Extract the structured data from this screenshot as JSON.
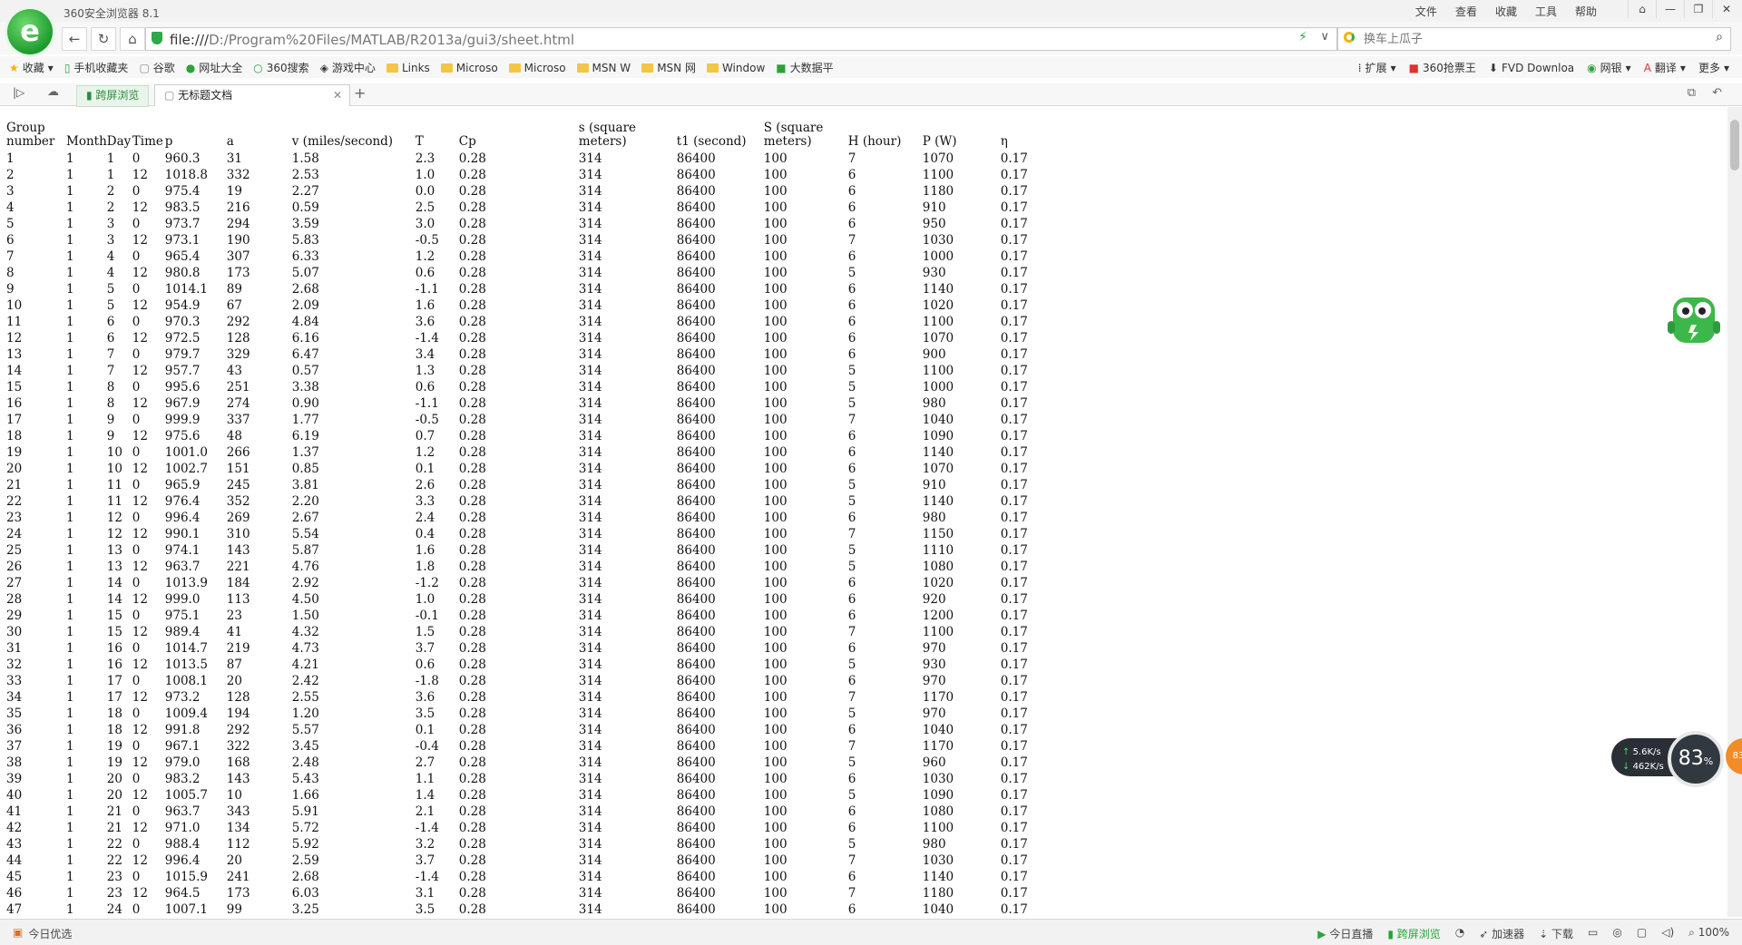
{
  "window": {
    "title": "360安全浏览器 8.1",
    "menus": [
      "文件",
      "查看",
      "收藏",
      "工具",
      "帮助"
    ]
  },
  "address": {
    "protocol": "file:///",
    "path": "D:/Program%20Files/MATLAB/R2013a/gui3/sheet.html"
  },
  "search": {
    "placeholder": "换车上瓜子"
  },
  "bookmarks": {
    "left": [
      "收藏",
      "手机收藏夹",
      "谷歌",
      "网址大全",
      "360搜索",
      "游戏中心",
      "Links",
      "Microso",
      "Microso",
      "MSN W",
      "MSN 网",
      "Window",
      "大数据平"
    ],
    "right": [
      "扩展",
      "360抢票王",
      "FVD Downloa",
      "网银",
      "翻译",
      "更多"
    ]
  },
  "tabs": {
    "cross_screen": "跨屏浏览",
    "active": "无标题文档",
    "new_tab": "+"
  },
  "table": {
    "headers": [
      "Group number",
      "Month",
      "Day",
      "Time",
      "p",
      "a",
      "v (miles/second)",
      "T",
      "Cp",
      "s (square meters)",
      "t1 (second)",
      "S (square meters)",
      "H (hour)",
      "P (W)",
      "η"
    ],
    "rows": [
      [
        "1",
        "1",
        "1",
        "0",
        "960.3",
        "31",
        "1.58",
        "2.3",
        "0.28",
        "314",
        "86400",
        "100",
        "7",
        "1070",
        "0.17"
      ],
      [
        "2",
        "1",
        "1",
        "12",
        "1018.8",
        "332",
        "2.53",
        "1.0",
        "0.28",
        "314",
        "86400",
        "100",
        "6",
        "1100",
        "0.17"
      ],
      [
        "3",
        "1",
        "2",
        "0",
        "975.4",
        "19",
        "2.27",
        "0.0",
        "0.28",
        "314",
        "86400",
        "100",
        "6",
        "1180",
        "0.17"
      ],
      [
        "4",
        "1",
        "2",
        "12",
        "983.5",
        "216",
        "0.59",
        "2.5",
        "0.28",
        "314",
        "86400",
        "100",
        "6",
        "910",
        "0.17"
      ],
      [
        "5",
        "1",
        "3",
        "0",
        "973.7",
        "294",
        "3.59",
        "3.0",
        "0.28",
        "314",
        "86400",
        "100",
        "6",
        "950",
        "0.17"
      ],
      [
        "6",
        "1",
        "3",
        "12",
        "973.1",
        "190",
        "5.83",
        "-0.5",
        "0.28",
        "314",
        "86400",
        "100",
        "7",
        "1030",
        "0.17"
      ],
      [
        "7",
        "1",
        "4",
        "0",
        "965.4",
        "307",
        "6.33",
        "1.2",
        "0.28",
        "314",
        "86400",
        "100",
        "6",
        "1000",
        "0.17"
      ],
      [
        "8",
        "1",
        "4",
        "12",
        "980.8",
        "173",
        "5.07",
        "0.6",
        "0.28",
        "314",
        "86400",
        "100",
        "5",
        "930",
        "0.17"
      ],
      [
        "9",
        "1",
        "5",
        "0",
        "1014.1",
        "89",
        "2.68",
        "-1.1",
        "0.28",
        "314",
        "86400",
        "100",
        "6",
        "1140",
        "0.17"
      ],
      [
        "10",
        "1",
        "5",
        "12",
        "954.9",
        "67",
        "2.09",
        "1.6",
        "0.28",
        "314",
        "86400",
        "100",
        "6",
        "1020",
        "0.17"
      ],
      [
        "11",
        "1",
        "6",
        "0",
        "970.3",
        "292",
        "4.84",
        "3.6",
        "0.28",
        "314",
        "86400",
        "100",
        "6",
        "1100",
        "0.17"
      ],
      [
        "12",
        "1",
        "6",
        "12",
        "972.5",
        "128",
        "6.16",
        "-1.4",
        "0.28",
        "314",
        "86400",
        "100",
        "6",
        "1070",
        "0.17"
      ],
      [
        "13",
        "1",
        "7",
        "0",
        "979.7",
        "329",
        "6.47",
        "3.4",
        "0.28",
        "314",
        "86400",
        "100",
        "6",
        "900",
        "0.17"
      ],
      [
        "14",
        "1",
        "7",
        "12",
        "957.7",
        "43",
        "0.57",
        "1.3",
        "0.28",
        "314",
        "86400",
        "100",
        "5",
        "1100",
        "0.17"
      ],
      [
        "15",
        "1",
        "8",
        "0",
        "995.6",
        "251",
        "3.38",
        "0.6",
        "0.28",
        "314",
        "86400",
        "100",
        "5",
        "1000",
        "0.17"
      ],
      [
        "16",
        "1",
        "8",
        "12",
        "967.9",
        "274",
        "0.90",
        "-1.1",
        "0.28",
        "314",
        "86400",
        "100",
        "5",
        "980",
        "0.17"
      ],
      [
        "17",
        "1",
        "9",
        "0",
        "999.9",
        "337",
        "1.77",
        "-0.5",
        "0.28",
        "314",
        "86400",
        "100",
        "7",
        "1040",
        "0.17"
      ],
      [
        "18",
        "1",
        "9",
        "12",
        "975.6",
        "48",
        "6.19",
        "0.7",
        "0.28",
        "314",
        "86400",
        "100",
        "6",
        "1090",
        "0.17"
      ],
      [
        "19",
        "1",
        "10",
        "0",
        "1001.0",
        "266",
        "1.37",
        "1.2",
        "0.28",
        "314",
        "86400",
        "100",
        "6",
        "1140",
        "0.17"
      ],
      [
        "20",
        "1",
        "10",
        "12",
        "1002.7",
        "151",
        "0.85",
        "0.1",
        "0.28",
        "314",
        "86400",
        "100",
        "6",
        "1070",
        "0.17"
      ],
      [
        "21",
        "1",
        "11",
        "0",
        "965.9",
        "245",
        "3.81",
        "2.6",
        "0.28",
        "314",
        "86400",
        "100",
        "5",
        "910",
        "0.17"
      ],
      [
        "22",
        "1",
        "11",
        "12",
        "976.4",
        "352",
        "2.20",
        "3.3",
        "0.28",
        "314",
        "86400",
        "100",
        "5",
        "1140",
        "0.17"
      ],
      [
        "23",
        "1",
        "12",
        "0",
        "996.4",
        "269",
        "2.67",
        "2.4",
        "0.28",
        "314",
        "86400",
        "100",
        "6",
        "980",
        "0.17"
      ],
      [
        "24",
        "1",
        "12",
        "12",
        "990.1",
        "310",
        "5.54",
        "0.4",
        "0.28",
        "314",
        "86400",
        "100",
        "7",
        "1150",
        "0.17"
      ],
      [
        "25",
        "1",
        "13",
        "0",
        "974.1",
        "143",
        "5.87",
        "1.6",
        "0.28",
        "314",
        "86400",
        "100",
        "5",
        "1110",
        "0.17"
      ],
      [
        "26",
        "1",
        "13",
        "12",
        "963.7",
        "221",
        "4.76",
        "1.8",
        "0.28",
        "314",
        "86400",
        "100",
        "5",
        "1080",
        "0.17"
      ],
      [
        "27",
        "1",
        "14",
        "0",
        "1013.9",
        "184",
        "2.92",
        "-1.2",
        "0.28",
        "314",
        "86400",
        "100",
        "6",
        "1020",
        "0.17"
      ],
      [
        "28",
        "1",
        "14",
        "12",
        "999.0",
        "113",
        "4.50",
        "1.0",
        "0.28",
        "314",
        "86400",
        "100",
        "6",
        "920",
        "0.17"
      ],
      [
        "29",
        "1",
        "15",
        "0",
        "975.1",
        "23",
        "1.50",
        "-0.1",
        "0.28",
        "314",
        "86400",
        "100",
        "6",
        "1200",
        "0.17"
      ],
      [
        "30",
        "1",
        "15",
        "12",
        "989.4",
        "41",
        "4.32",
        "1.5",
        "0.28",
        "314",
        "86400",
        "100",
        "7",
        "1100",
        "0.17"
      ],
      [
        "31",
        "1",
        "16",
        "0",
        "1014.7",
        "219",
        "4.73",
        "3.7",
        "0.28",
        "314",
        "86400",
        "100",
        "6",
        "970",
        "0.17"
      ],
      [
        "32",
        "1",
        "16",
        "12",
        "1013.5",
        "87",
        "4.21",
        "0.6",
        "0.28",
        "314",
        "86400",
        "100",
        "5",
        "930",
        "0.17"
      ],
      [
        "33",
        "1",
        "17",
        "0",
        "1008.1",
        "20",
        "2.42",
        "-1.8",
        "0.28",
        "314",
        "86400",
        "100",
        "6",
        "970",
        "0.17"
      ],
      [
        "34",
        "1",
        "17",
        "12",
        "973.2",
        "128",
        "2.55",
        "3.6",
        "0.28",
        "314",
        "86400",
        "100",
        "7",
        "1170",
        "0.17"
      ],
      [
        "35",
        "1",
        "18",
        "0",
        "1009.4",
        "194",
        "1.20",
        "3.5",
        "0.28",
        "314",
        "86400",
        "100",
        "5",
        "970",
        "0.17"
      ],
      [
        "36",
        "1",
        "18",
        "12",
        "991.8",
        "292",
        "5.57",
        "0.1",
        "0.28",
        "314",
        "86400",
        "100",
        "6",
        "1040",
        "0.17"
      ],
      [
        "37",
        "1",
        "19",
        "0",
        "967.1",
        "322",
        "3.45",
        "-0.4",
        "0.28",
        "314",
        "86400",
        "100",
        "7",
        "1170",
        "0.17"
      ],
      [
        "38",
        "1",
        "19",
        "12",
        "979.0",
        "168",
        "2.48",
        "2.7",
        "0.28",
        "314",
        "86400",
        "100",
        "5",
        "960",
        "0.17"
      ],
      [
        "39",
        "1",
        "20",
        "0",
        "983.2",
        "143",
        "5.43",
        "1.1",
        "0.28",
        "314",
        "86400",
        "100",
        "6",
        "1030",
        "0.17"
      ],
      [
        "40",
        "1",
        "20",
        "12",
        "1005.7",
        "10",
        "1.66",
        "1.4",
        "0.28",
        "314",
        "86400",
        "100",
        "5",
        "1090",
        "0.17"
      ],
      [
        "41",
        "1",
        "21",
        "0",
        "963.7",
        "343",
        "5.91",
        "2.1",
        "0.28",
        "314",
        "86400",
        "100",
        "6",
        "1080",
        "0.17"
      ],
      [
        "42",
        "1",
        "21",
        "12",
        "971.0",
        "134",
        "5.72",
        "-1.4",
        "0.28",
        "314",
        "86400",
        "100",
        "6",
        "1100",
        "0.17"
      ],
      [
        "43",
        "1",
        "22",
        "0",
        "988.4",
        "112",
        "5.92",
        "3.2",
        "0.28",
        "314",
        "86400",
        "100",
        "5",
        "980",
        "0.17"
      ],
      [
        "44",
        "1",
        "22",
        "12",
        "996.4",
        "20",
        "2.59",
        "3.7",
        "0.28",
        "314",
        "86400",
        "100",
        "7",
        "1030",
        "0.17"
      ],
      [
        "45",
        "1",
        "23",
        "0",
        "1015.9",
        "241",
        "2.68",
        "-1.4",
        "0.28",
        "314",
        "86400",
        "100",
        "6",
        "1140",
        "0.17"
      ],
      [
        "46",
        "1",
        "23",
        "12",
        "964.5",
        "173",
        "6.03",
        "3.1",
        "0.28",
        "314",
        "86400",
        "100",
        "7",
        "1180",
        "0.17"
      ],
      [
        "47",
        "1",
        "24",
        "0",
        "1007.1",
        "99",
        "3.25",
        "3.5",
        "0.28",
        "314",
        "86400",
        "100",
        "6",
        "1040",
        "0.17"
      ]
    ]
  },
  "speed_widget": {
    "up": "5.6K/s",
    "down": "462K/s",
    "cpu": "83",
    "cpu_unit": "%",
    "badge": "83"
  },
  "status": {
    "left": "今日优选",
    "right": [
      "今日直播",
      "跨屏浏览",
      "加速器",
      "下载",
      "100%"
    ]
  },
  "colors": {
    "accent_green": "#2aa33b",
    "folder": "#f3c646"
  },
  "icons": [
    "logo-icon",
    "shield-icon",
    "bolt-icon",
    "search-icon",
    "star-icon",
    "folder-icon",
    "cloud-icon",
    "close-icon",
    "mascot-icon"
  ]
}
